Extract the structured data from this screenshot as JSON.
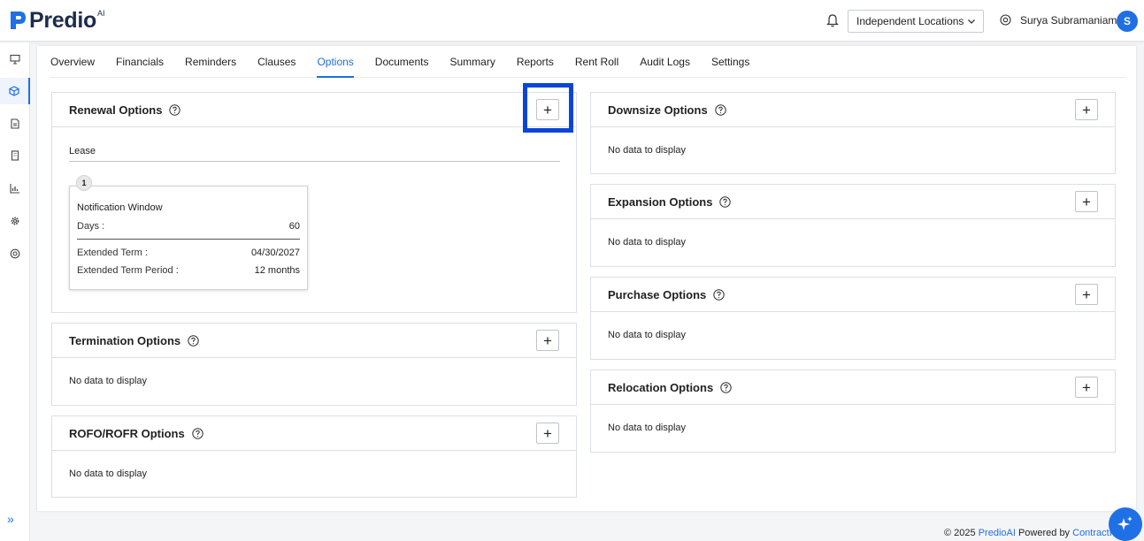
{
  "app": {
    "name": "Predio",
    "name_sup": "AI"
  },
  "header": {
    "location_select": "Independent Locations",
    "user_name": "Surya Subramaniam",
    "avatar_initial": "S"
  },
  "tabs": [
    {
      "label": "Overview"
    },
    {
      "label": "Financials"
    },
    {
      "label": "Reminders"
    },
    {
      "label": "Clauses"
    },
    {
      "label": "Options",
      "active": true
    },
    {
      "label": "Documents"
    },
    {
      "label": "Summary"
    },
    {
      "label": "Reports"
    },
    {
      "label": "Rent Roll"
    },
    {
      "label": "Audit Logs"
    },
    {
      "label": "Settings"
    }
  ],
  "renewal": {
    "title": "Renewal Options",
    "add_label": "+",
    "section_label": "Lease",
    "item_number": "1",
    "notification_window": "Notification Window",
    "days_label": "Days :",
    "days_value": "60",
    "extended_term_label": "Extended Term :",
    "extended_term_value": "04/30/2027",
    "extended_period_label": "Extended Term Period :",
    "extended_period_value": "12 months"
  },
  "termination": {
    "title": "Termination Options",
    "add_label": "+",
    "empty": "No data to display"
  },
  "rofo": {
    "title": "ROFO/ROFR Options",
    "add_label": "+",
    "empty": "No data to display"
  },
  "downsize": {
    "title": "Downsize Options",
    "add_label": "+",
    "empty": "No data to display"
  },
  "expansion": {
    "title": "Expansion Options",
    "add_label": "+",
    "empty": "No data to display"
  },
  "purchase": {
    "title": "Purchase Options",
    "add_label": "+",
    "empty": "No data to display"
  },
  "relocation": {
    "title": "Relocation Options",
    "add_label": "+",
    "empty": "No data to display"
  },
  "footer": {
    "copyright": "© 2025",
    "brand_link": "PredioAI",
    "powered_by": "Powered by",
    "company_link": "ContractIQ"
  },
  "colors": {
    "accent": "#1f6fe5",
    "highlight": "#0a45d9",
    "brand_text": "#1d2b4f"
  }
}
